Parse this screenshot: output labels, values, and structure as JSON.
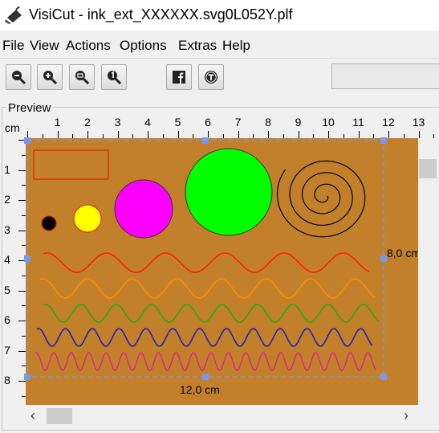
{
  "window": {
    "app_name": "VisiCut",
    "separator": " - ",
    "filename": "ink_ext_XXXXXX.svg0L052Y.plf"
  },
  "menu": [
    "File",
    "View",
    "Actions",
    "Options",
    "Extras",
    "Help"
  ],
  "toolbar": {
    "buttons": [
      {
        "name": "zoom-out-button",
        "icon": "zoom-out-icon"
      },
      {
        "name": "zoom-in-button",
        "icon": "zoom-in-icon"
      },
      {
        "name": "zoom-fit-button",
        "icon": "zoom-fit-icon"
      },
      {
        "name": "zoom-100-button",
        "icon": "zoom-actual-icon"
      },
      {
        "name": "facebook-button",
        "icon": "facebook-icon"
      },
      {
        "name": "thingiverse-button",
        "icon": "thingiverse-icon"
      }
    ]
  },
  "preview": {
    "title": "Preview",
    "unit": "cm",
    "top_ruler": [
      "1",
      "2",
      "3",
      "4",
      "5",
      "6",
      "7",
      "8",
      "9",
      "10",
      "11",
      "12",
      "13"
    ],
    "left_ruler": [
      "1",
      "2",
      "3",
      "4",
      "5",
      "6",
      "7",
      "8"
    ],
    "width_label": "12,0 cm",
    "height_label": "8,0 cm",
    "colors": {
      "material": "#c2802a",
      "selection": "#7a96f0",
      "rect_outline": "#e02000",
      "black_dot": "#000000",
      "yellow_dot": "#ffff00",
      "magenta_dot": "#ff00ff",
      "green_dot": "#00ff00",
      "spiral": "#000000",
      "wave_red": "#ff2000",
      "wave_orange": "#ff8c00",
      "wave_green": "#2eaa10",
      "wave_blue": "#2020b8",
      "wave_pink": "#e0208c"
    }
  },
  "scrollbars": {
    "left_arrow": "‹",
    "right_arrow": "›"
  }
}
